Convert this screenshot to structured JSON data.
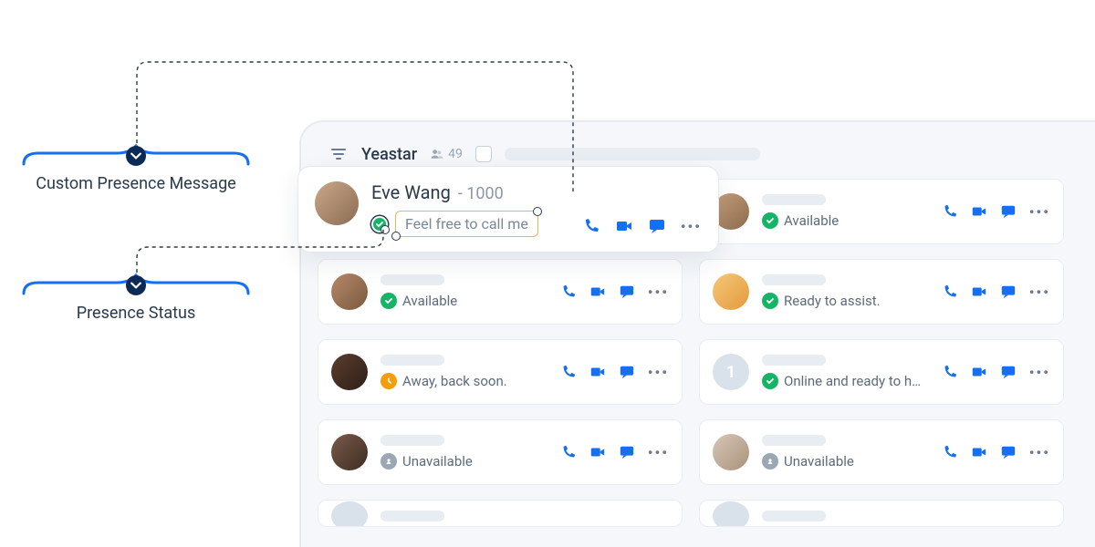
{
  "annotations": {
    "custom_message": "Custom Presence Message",
    "presence_status": "Presence Status"
  },
  "topbar": {
    "title": "Yeastar",
    "count": "49"
  },
  "hero": {
    "name": "Eve Wang",
    "ext": "- 1000",
    "status": "available",
    "message": "Feel free to call me"
  },
  "cards": [
    {
      "status": "available",
      "text": "Available"
    },
    {
      "status": "available",
      "text": "Available"
    },
    {
      "status": "available",
      "text": "Ready to assist."
    },
    {
      "status": "away",
      "text": "Away, back soon."
    },
    {
      "status": "available",
      "text": "Online and ready to h…",
      "num": "1"
    },
    {
      "status": "unavailable",
      "text": "Unavailable"
    },
    {
      "status": "unavailable",
      "text": "Unavailable"
    }
  ],
  "icons": {
    "call": "call",
    "video": "video",
    "chat": "chat",
    "more": "•••"
  }
}
